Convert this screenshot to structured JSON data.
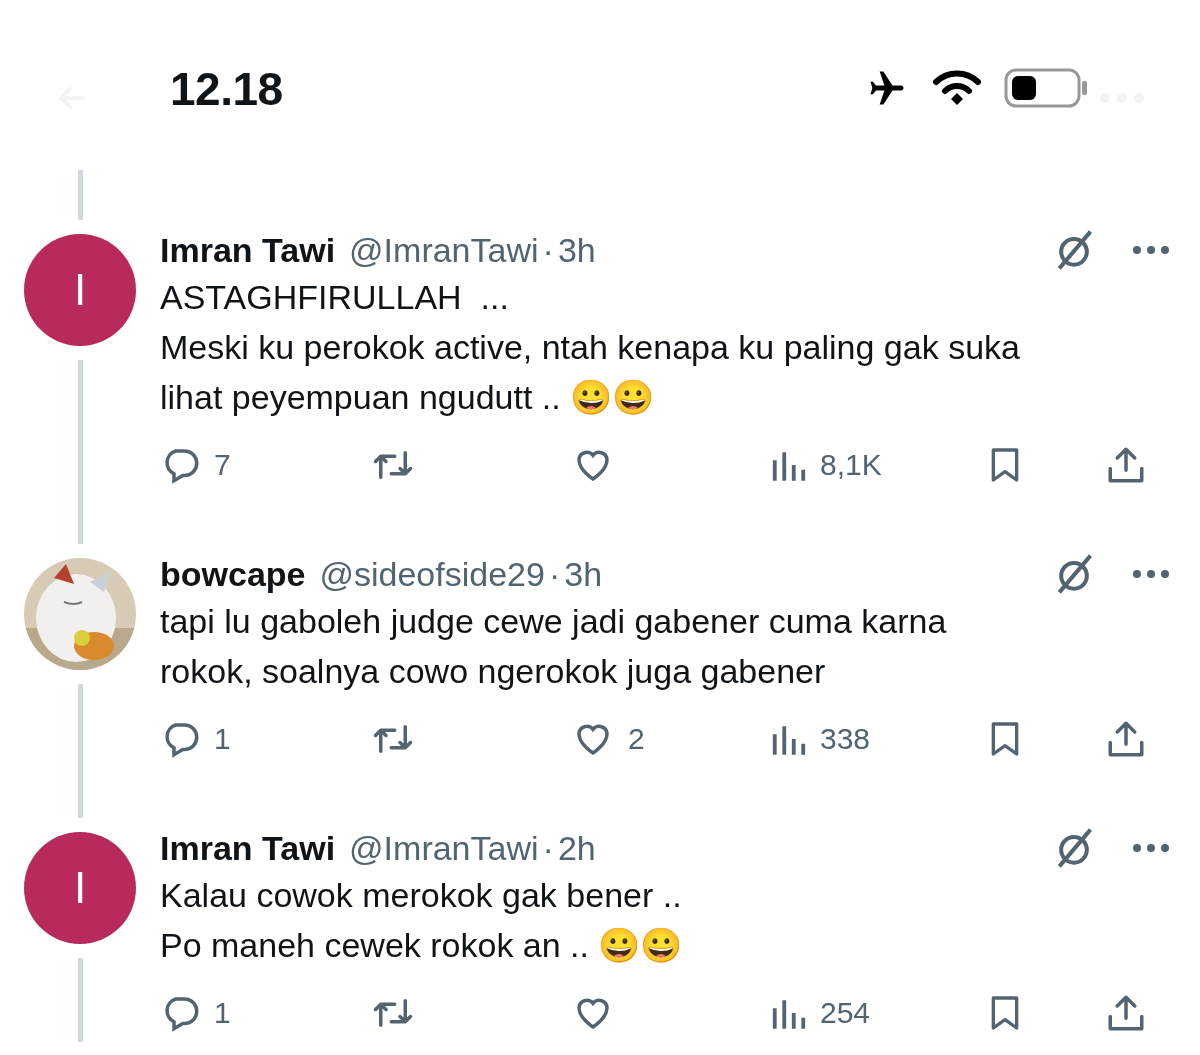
{
  "status_bar": {
    "time": "12.18"
  },
  "separator": "·",
  "tweets": [
    {
      "author": {
        "name": "Imran Tawi",
        "handle": "@ImranTawi",
        "time": "3h",
        "avatar": {
          "kind": "letter",
          "letter": "I",
          "color": "#b82a5c"
        }
      },
      "lines": [
        "ASTAGHFIRULLAH  ...",
        "Meski ku perokok active, ntah kenapa ku paling gak suka",
        "lihat peyempuan ngudutt .. 😀😀"
      ],
      "stats": {
        "replies": "7",
        "views": "8,1K"
      }
    },
    {
      "author": {
        "name": "bowcape",
        "handle": "@sideofside29",
        "time": "3h"
      },
      "lines": [
        "tapi lu gaboleh judge cewe jadi gabener cuma karna",
        "rokok, soalnya cowo ngerokok juga gabener"
      ],
      "stats": {
        "replies": "1",
        "likes": "2",
        "views": "338"
      }
    },
    {
      "author": {
        "name": "Imran Tawi",
        "handle": "@ImranTawi",
        "time": "2h",
        "avatar": {
          "kind": "letter",
          "letter": "I",
          "color": "#b82a5c"
        }
      },
      "lines": [
        "Kalau cowok merokok gak bener ..",
        "Po maneh cewek rokok an .. 😀😀"
      ],
      "stats": {
        "replies": "1",
        "views": "254"
      }
    }
  ]
}
